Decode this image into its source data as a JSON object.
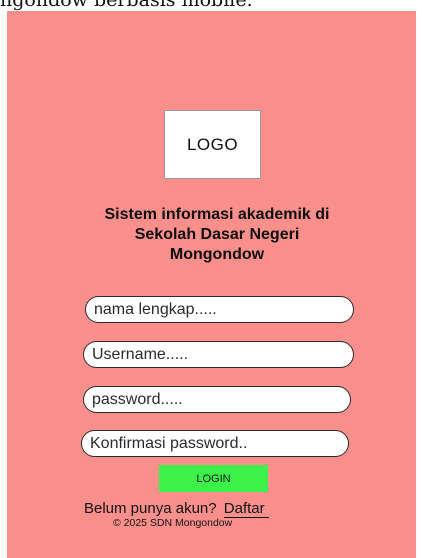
{
  "caption_fragment": "ngondow berbasis mobile.",
  "logo": {
    "label": "LOGO"
  },
  "title": {
    "line1": "Sistem informasi akademik di",
    "line2": "Sekolah Dasar Negeri",
    "line3": "Mongondow"
  },
  "form": {
    "fullname_placeholder": "nama lengkap.....",
    "username_placeholder": "Username.....",
    "password_placeholder": "password.....",
    "confirm_placeholder": "Konfirmasi password..",
    "login_label": "LOGIN"
  },
  "signup": {
    "prompt": "Belum punya akun?",
    "link_label": "Daftar"
  },
  "footer": {
    "copyright": "© 2025 SDN Mongondow"
  },
  "colors": {
    "background": "#fb8f8c",
    "login_button": "#3cf24a",
    "input_background": "#ffffff"
  }
}
